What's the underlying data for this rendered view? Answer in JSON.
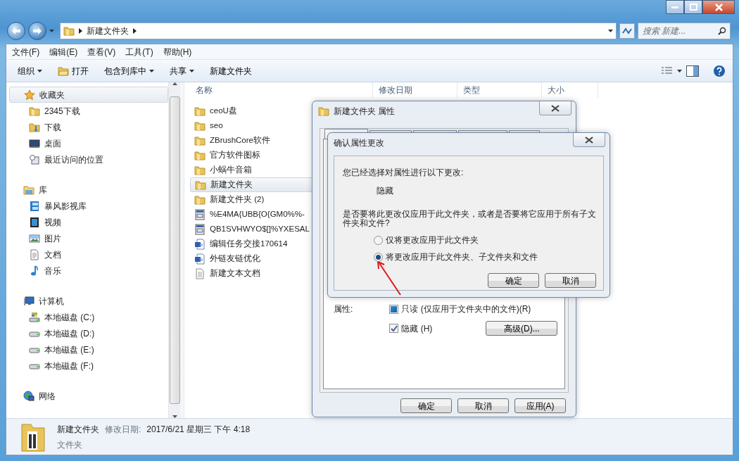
{
  "address": {
    "crumbs": [
      "新建文件夹"
    ],
    "search_placeholder": "搜索 新建..."
  },
  "menu": [
    "文件(F)",
    "编辑(E)",
    "查看(V)",
    "工具(T)",
    "帮助(H)"
  ],
  "toolbar": [
    {
      "label": "组织",
      "kind": "dropdown"
    },
    {
      "label": "打开",
      "kind": "open"
    },
    {
      "label": "包含到库中",
      "kind": "dropdown"
    },
    {
      "label": "共享",
      "kind": "dropdown"
    },
    {
      "label": "新建文件夹",
      "kind": "plain"
    }
  ],
  "nav": [
    {
      "label": "收藏夹",
      "selected": true,
      "children": [
        {
          "label": "2345下载",
          "selected": false
        },
        {
          "label": "下载",
          "selected": false
        },
        {
          "label": "桌面",
          "selected": false
        },
        {
          "label": "最近访问的位置",
          "selected": false
        }
      ]
    },
    {
      "label": "库",
      "selected": false,
      "children": [
        {
          "label": "暴风影视库",
          "selected": false
        },
        {
          "label": "视频",
          "selected": false
        },
        {
          "label": "图片",
          "selected": false
        },
        {
          "label": "文档",
          "selected": false
        },
        {
          "label": "音乐",
          "selected": false
        }
      ]
    },
    {
      "label": "计算机",
      "selected": false,
      "children": [
        {
          "label": "本地磁盘 (C:)",
          "selected": false
        },
        {
          "label": "本地磁盘 (D:)",
          "selected": false
        },
        {
          "label": "本地磁盘 (E:)",
          "selected": false
        },
        {
          "label": "本地磁盘 (F:)",
          "selected": false
        }
      ]
    },
    {
      "label": "网络",
      "selected": false
    }
  ],
  "columns": [
    "名称",
    "修改日期",
    "类型",
    "大小"
  ],
  "files": [
    {
      "name": "ceoU盘",
      "kind": "folder",
      "selected": false
    },
    {
      "name": "seo",
      "kind": "folder",
      "selected": false
    },
    {
      "name": "ZBrushCore软件",
      "kind": "folder",
      "selected": false
    },
    {
      "name": "官方软件图标",
      "kind": "folder",
      "selected": false
    },
    {
      "name": "小蜗牛音箱",
      "kind": "folder",
      "selected": false
    },
    {
      "name": "新建文件夹",
      "kind": "folder",
      "selected": true
    },
    {
      "name": "新建文件夹 (2)",
      "kind": "folder",
      "selected": false
    },
    {
      "name": "%E4MA{UBB{O{GM0%%-",
      "kind": "web",
      "selected": false
    },
    {
      "name": "QB1SVHWYO$[]%YXESAL",
      "kind": "web",
      "selected": false
    },
    {
      "name": "编辑任务交接170614",
      "kind": "word",
      "selected": false
    },
    {
      "name": "外链友链优化",
      "kind": "word",
      "selected": false
    },
    {
      "name": "新建文本文档",
      "kind": "text",
      "selected": false
    }
  ],
  "properties_dialog": {
    "title": "新建文件夹 属性",
    "tabs": [
      {
        "selected": true
      },
      {
        "selected": false
      },
      {
        "selected": false
      },
      {
        "selected": false
      },
      {
        "selected": false
      }
    ],
    "attributes_label": "属性:",
    "attributes": [
      {
        "label": "只读 (仅应用于文件夹中的文件)(R)",
        "checked": false,
        "indeterminate": true
      },
      {
        "label": "隐藏 (H)",
        "checked": true,
        "indeterminate": false
      }
    ],
    "advanced_button": "高级(D)...",
    "buttons": [
      "确定",
      "取消",
      "应用(A)"
    ]
  },
  "confirm_dialog": {
    "title": "确认属性更改",
    "intro": "您已经选择对属性进行以下更改:",
    "change": "隐藏",
    "question": "是否要将此更改仅应用于此文件夹，或者是否要将它应用于所有子文件夹和文件?",
    "options": [
      {
        "label": "仅将更改应用于此文件夹",
        "selected": false
      },
      {
        "label": "将更改应用于此文件夹、子文件夹和文件",
        "selected": true
      }
    ],
    "buttons": [
      "确定",
      "取消"
    ]
  },
  "details": {
    "name": "新建文件夹",
    "date_label": "修改日期:",
    "date": "2017/6/21 星期三 下午 4:18",
    "type": "文件夹"
  }
}
